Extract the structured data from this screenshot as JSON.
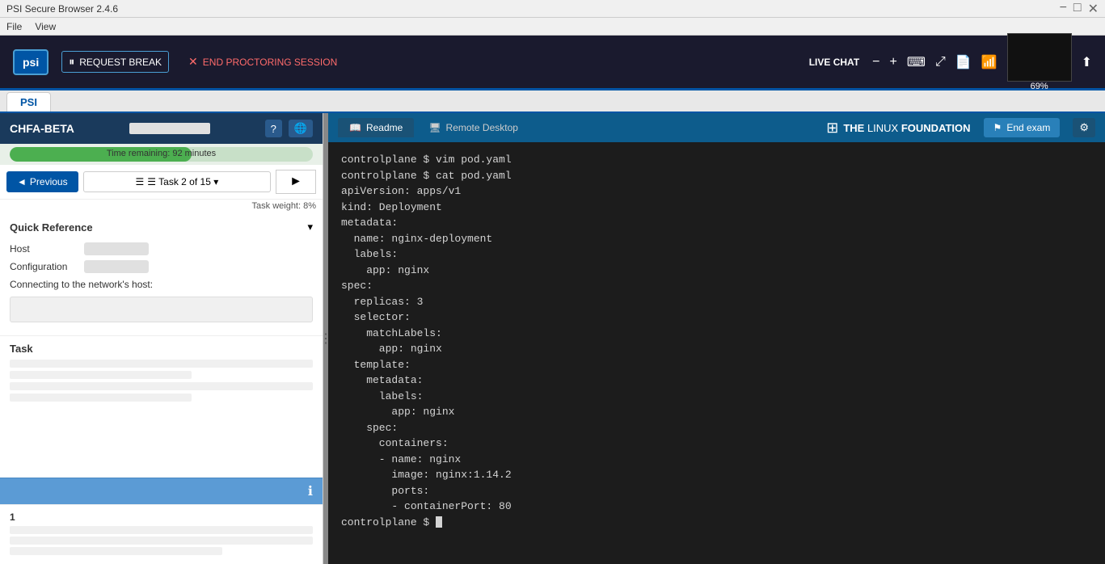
{
  "titleBar": {
    "appName": "PSI Secure Browser 2.4.6",
    "minBtn": "−",
    "maxBtn": "□",
    "closeBtn": "✕"
  },
  "menuBar": {
    "items": [
      "File",
      "View"
    ]
  },
  "toolbar": {
    "logo": "psi",
    "requestBreakLabel": "REQUEST BREAK",
    "endProctorLabel": "END PROCTORING SESSION",
    "liveChatLabel": "LIVE CHAT",
    "zoomLabel": "69%"
  },
  "tabBar": {
    "tab": "PSI"
  },
  "leftPanel": {
    "examTitle": "CHFA-BETA",
    "timeRemaining": "Time remaining: 92 minutes",
    "prevBtn": "◄ Previous",
    "taskLabel": "☰ Task 2 of 15 ▾",
    "nextBtn": "►",
    "taskWeight": "Task weight: 8%",
    "quickRef": {
      "title": "Quick Reference",
      "hostLabel": "Host",
      "configLabel": "Configuration",
      "networkText": "Connecting to the network's host:"
    },
    "task": {
      "title": "Task"
    },
    "infoText": "",
    "questionNum": "1"
  },
  "rightPanel": {
    "readmeTab": "Readme",
    "remoteDesktopTab": "Remote Desktop",
    "endExamBtn": "End exam",
    "linuxFoundation": "THE LINUX FOUNDATION",
    "terminal": {
      "lines": [
        "controlplane $ vim pod.yaml",
        "controlplane $ cat pod.yaml",
        "apiVersion: apps/v1",
        "kind: Deployment",
        "metadata:",
        "  name: nginx-deployment",
        "  labels:",
        "    app: nginx",
        "spec:",
        "  replicas: 3",
        "  selector:",
        "    matchLabels:",
        "      app: nginx",
        "  template:",
        "    metadata:",
        "      labels:",
        "        app: nginx",
        "    spec:",
        "      containers:",
        "      - name: nginx",
        "        image: nginx:1.14.2",
        "        ports:",
        "        - containerPort: 80",
        "controlplane $ "
      ]
    }
  }
}
